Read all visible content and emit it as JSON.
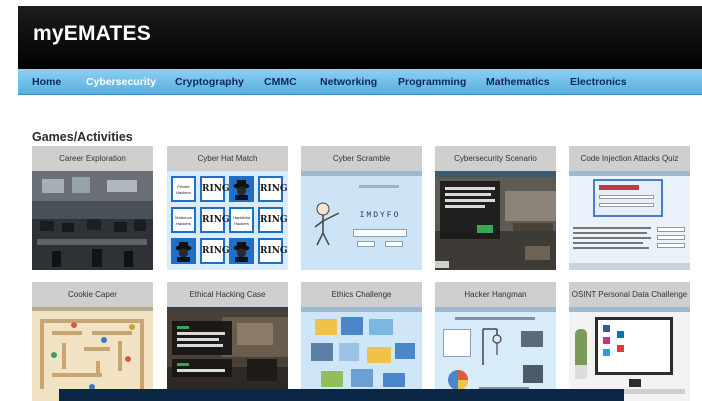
{
  "header": {
    "brand": "myEMATES"
  },
  "nav": {
    "items": [
      {
        "label": "Home"
      },
      {
        "label": "Cybersecurity"
      },
      {
        "label": "Cryptography"
      },
      {
        "label": "CMMC"
      },
      {
        "label": "Networking"
      },
      {
        "label": "Programming"
      },
      {
        "label": "Mathematics"
      },
      {
        "label": "Electronics"
      }
    ]
  },
  "section": {
    "title": "Games/Activities"
  },
  "cards": [
    {
      "title": "Career Exploration"
    },
    {
      "title": "Cyber Hat Match"
    },
    {
      "title": "Cyber Scramble"
    },
    {
      "title": "Cybersecurity Scenario"
    },
    {
      "title": "Code Injection Attacks Quiz"
    },
    {
      "title": "Cookie Caper"
    },
    {
      "title": "Ethical Hacking Case"
    },
    {
      "title": "Ethics Challenge"
    },
    {
      "title": "Hacker Hangman"
    },
    {
      "title": "OSINT Personal Data Challenge"
    }
  ],
  "thumbs": {
    "hat_match": {
      "tile_text": "RING",
      "label_1": "Private Hackers",
      "label_2": "Malicious Hackers",
      "label_3": "Hacktivist Hackers"
    },
    "scramble": {
      "word": "IMDYFO"
    }
  },
  "colors": {
    "nav_active": "#ffffff",
    "nav_text": "#0e2a63",
    "header_bg": "#000000",
    "nav_bg": "#6ec0ea"
  }
}
